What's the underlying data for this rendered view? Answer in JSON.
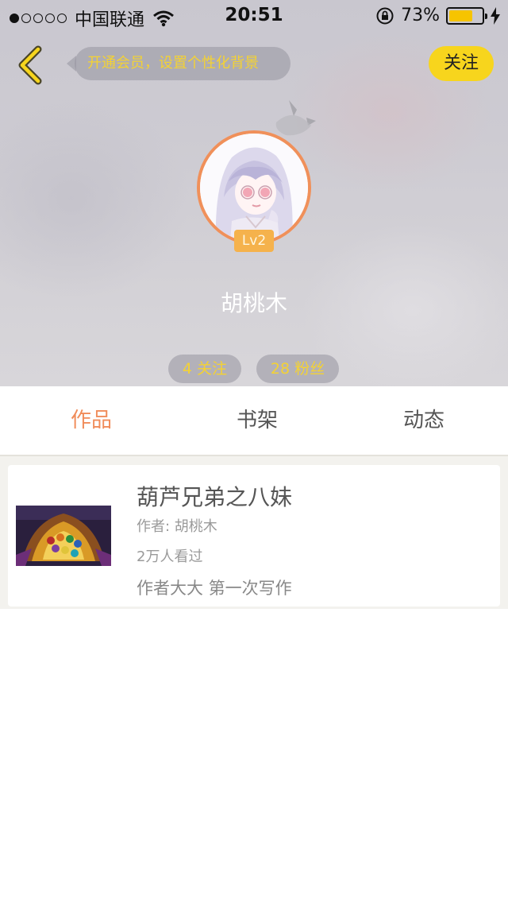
{
  "status_bar": {
    "carrier": "中国联通",
    "time": "20:51",
    "battery": "73%",
    "battery_level": 0.73,
    "signal_bars": 1,
    "signal_total": 5
  },
  "header": {
    "tip": "开通会员，设置个性化背景",
    "follow_button": "关注"
  },
  "profile": {
    "level": "Lv2",
    "name": "胡桃木",
    "following": "4 关注",
    "followers": "28 粉丝"
  },
  "tabs": [
    {
      "label": "作品",
      "active": true
    },
    {
      "label": "书架",
      "active": false
    },
    {
      "label": "动态",
      "active": false
    }
  ],
  "works": [
    {
      "title": "葫芦兄弟之八妹",
      "author": "作者: 胡桃木",
      "views": "2万人看过",
      "description": "作者大大 第一次写作"
    }
  ],
  "colors": {
    "accent": "#f08c5a",
    "follow_bg": "#f7d51d",
    "pill_text": "#f4d233",
    "level_badge": "#f5b24c"
  },
  "icons": {
    "back": "chevron-left-icon",
    "wifi": "wifi-icon",
    "rotation_lock": "rotation-lock-icon",
    "charging": "charging-bolt-icon"
  }
}
